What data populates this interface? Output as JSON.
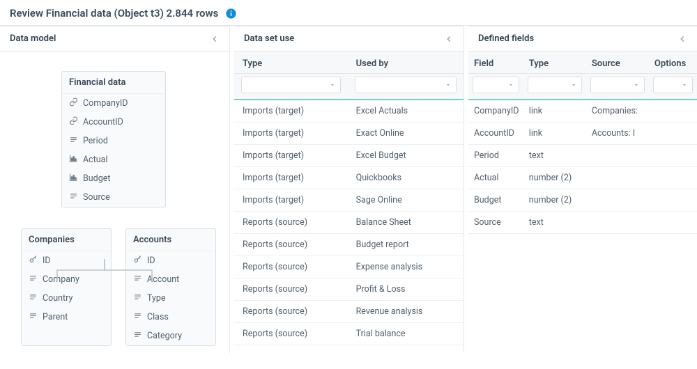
{
  "header": {
    "title": "Review Financial data (Object t3) 2.844 rows"
  },
  "panels": {
    "data_model": {
      "title": "Data model"
    },
    "data_set_use": {
      "title": "Data set use"
    },
    "defined_fields": {
      "title": "Defined fields"
    }
  },
  "data_model": {
    "main": {
      "title": "Financial data",
      "fields": [
        {
          "icon": "link",
          "label": "CompanyID"
        },
        {
          "icon": "link",
          "label": "AccountID"
        },
        {
          "icon": "text",
          "label": "Period"
        },
        {
          "icon": "chart",
          "label": "Actual"
        },
        {
          "icon": "chart",
          "label": "Budget"
        },
        {
          "icon": "text",
          "label": "Source"
        }
      ]
    },
    "children": [
      {
        "title": "Companies",
        "fields": [
          {
            "icon": "key",
            "label": "ID"
          },
          {
            "icon": "text",
            "label": "Company"
          },
          {
            "icon": "text",
            "label": "Country"
          },
          {
            "icon": "text",
            "label": "Parent"
          }
        ]
      },
      {
        "title": "Accounts",
        "fields": [
          {
            "icon": "key",
            "label": "ID"
          },
          {
            "icon": "text",
            "label": "Account"
          },
          {
            "icon": "text",
            "label": "Type"
          },
          {
            "icon": "text",
            "label": "Class"
          },
          {
            "icon": "text",
            "label": "Category"
          }
        ]
      }
    ]
  },
  "data_set_use": {
    "columns": [
      "Type",
      "Used by"
    ],
    "rows": [
      {
        "type": "Imports (target)",
        "used_by": "Excel Actuals"
      },
      {
        "type": "Imports (target)",
        "used_by": "Exact Online"
      },
      {
        "type": "Imports (target)",
        "used_by": "Excel Budget"
      },
      {
        "type": "Imports (target)",
        "used_by": "Quickbooks"
      },
      {
        "type": "Imports (target)",
        "used_by": "Sage Online"
      },
      {
        "type": "Reports (source)",
        "used_by": "Balance Sheet"
      },
      {
        "type": "Reports (source)",
        "used_by": "Budget report"
      },
      {
        "type": "Reports (source)",
        "used_by": "Expense analysis"
      },
      {
        "type": "Reports (source)",
        "used_by": "Profit & Loss"
      },
      {
        "type": "Reports (source)",
        "used_by": "Revenue analysis"
      },
      {
        "type": "Reports (source)",
        "used_by": "Trial balance"
      }
    ]
  },
  "defined_fields": {
    "columns": [
      "Field",
      "Type",
      "Source",
      "Options"
    ],
    "rows": [
      {
        "field": "CompanyID",
        "type": "link",
        "source": "Companies:",
        "options": ""
      },
      {
        "field": "AccountID",
        "type": "link",
        "source": "Accounts: I",
        "options": ""
      },
      {
        "field": "Period",
        "type": "text",
        "source": "",
        "options": ""
      },
      {
        "field": "Actual",
        "type": "number (2)",
        "source": "",
        "options": ""
      },
      {
        "field": "Budget",
        "type": "number (2)",
        "source": "",
        "options": ""
      },
      {
        "field": "Source",
        "type": "text",
        "source": "",
        "options": ""
      }
    ]
  }
}
